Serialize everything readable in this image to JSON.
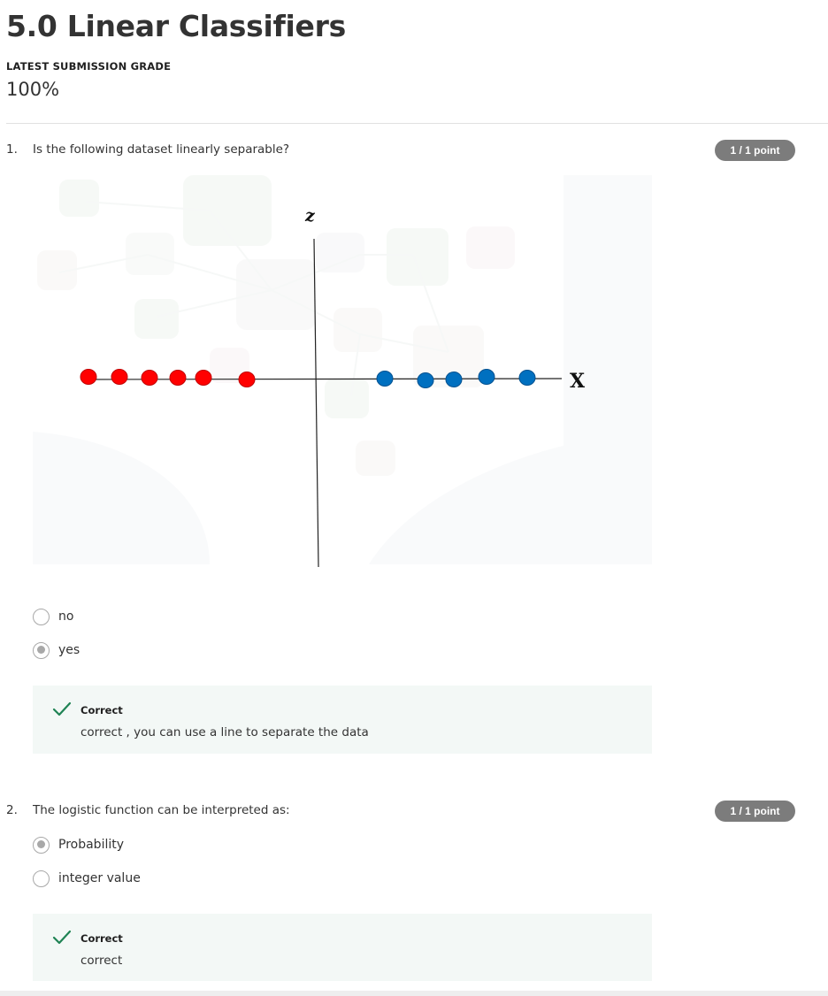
{
  "header": {
    "title": "5.0 Linear Classifiers",
    "grade_label": "LATEST SUBMISSION GRADE",
    "grade_value": "100%"
  },
  "questions": [
    {
      "number": "1.",
      "text": "Is the following dataset linearly separable?",
      "points": "1 / 1 point",
      "figure": {
        "z_label": "z",
        "x_label": "X",
        "red_color": "#ff0000",
        "blue_color": "#0070c0"
      },
      "options": [
        {
          "label": "no",
          "selected": false
        },
        {
          "label": "yes",
          "selected": true
        }
      ],
      "feedback": {
        "title": "Correct",
        "text": "correct , you can use a line to separate the data"
      }
    },
    {
      "number": "2.",
      "text": "The logistic function can be interpreted as:",
      "points": "1 / 1 point",
      "options": [
        {
          "label": "Probability",
          "selected": true
        },
        {
          "label": "integer value",
          "selected": false
        }
      ],
      "feedback": {
        "title": "Correct",
        "text": "correct"
      }
    }
  ],
  "colors": {
    "badge": "#7c7c7c",
    "feedback_bg": "#f3f8f6",
    "check": "#1f8354"
  }
}
